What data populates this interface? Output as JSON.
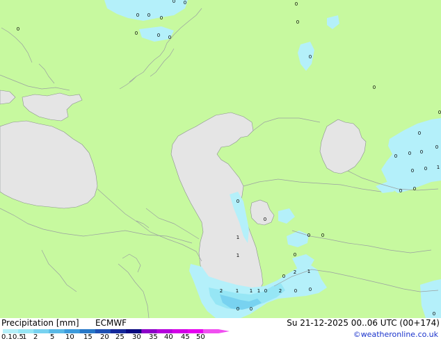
{
  "footer": {
    "title": "Precipitation [mm]",
    "model": "ECMWF",
    "datetime": "Su 21-12-2025 00..06 UTC (00+174)",
    "credit": "©weatheronline.co.uk"
  },
  "legend": {
    "ticks": [
      "0.1",
      "0.5",
      "1",
      "2",
      "5",
      "10",
      "15",
      "20",
      "25",
      "30",
      "35",
      "40",
      "45",
      "50"
    ],
    "colors": [
      "#b4f0fa",
      "#96e6f5",
      "#78d2f0",
      "#5ab9e6",
      "#3c9bdc",
      "#2878c8",
      "#1e50b4",
      "#14289b",
      "#0a0a80",
      "#8c00c8",
      "#b400dc",
      "#d200e6",
      "#e600f0",
      "#f050f0"
    ]
  },
  "colors": {
    "land": "#c7f99f",
    "water": "#e5e5e5",
    "border": "#9aa0a0",
    "precip_light": "#b4f0fa",
    "precip_mid": "#96e6f5",
    "precip_heavy": "#78d2f0"
  },
  "labels": [
    {
      "text": "0"
    },
    {
      "text": "0"
    },
    {
      "text": "0"
    },
    {
      "text": "0"
    },
    {
      "text": "0"
    },
    {
      "text": "0"
    },
    {
      "text": "0"
    },
    {
      "text": "0"
    },
    {
      "text": "0"
    },
    {
      "text": "0"
    },
    {
      "text": "0"
    },
    {
      "text": "0"
    },
    {
      "text": "0"
    },
    {
      "text": "0"
    },
    {
      "text": "0"
    },
    {
      "text": "0"
    },
    {
      "text": "0"
    },
    {
      "text": "0"
    },
    {
      "text": "1"
    },
    {
      "text": "1"
    },
    {
      "text": "1"
    },
    {
      "text": "1"
    },
    {
      "text": "1"
    },
    {
      "text": "0"
    },
    {
      "text": "2"
    },
    {
      "text": "2"
    },
    {
      "text": "0"
    },
    {
      "text": "0"
    },
    {
      "text": "2"
    },
    {
      "text": "0"
    },
    {
      "text": "0"
    },
    {
      "text": "1"
    },
    {
      "text": "0"
    },
    {
      "text": "0"
    },
    {
      "text": "0"
    },
    {
      "text": "0"
    },
    {
      "text": "0"
    },
    {
      "text": "0"
    },
    {
      "text": "0"
    },
    {
      "text": "1"
    },
    {
      "text": "0"
    },
    {
      "text": "0"
    },
    {
      "text": "0"
    },
    {
      "text": "0"
    },
    {
      "text": "0"
    }
  ]
}
